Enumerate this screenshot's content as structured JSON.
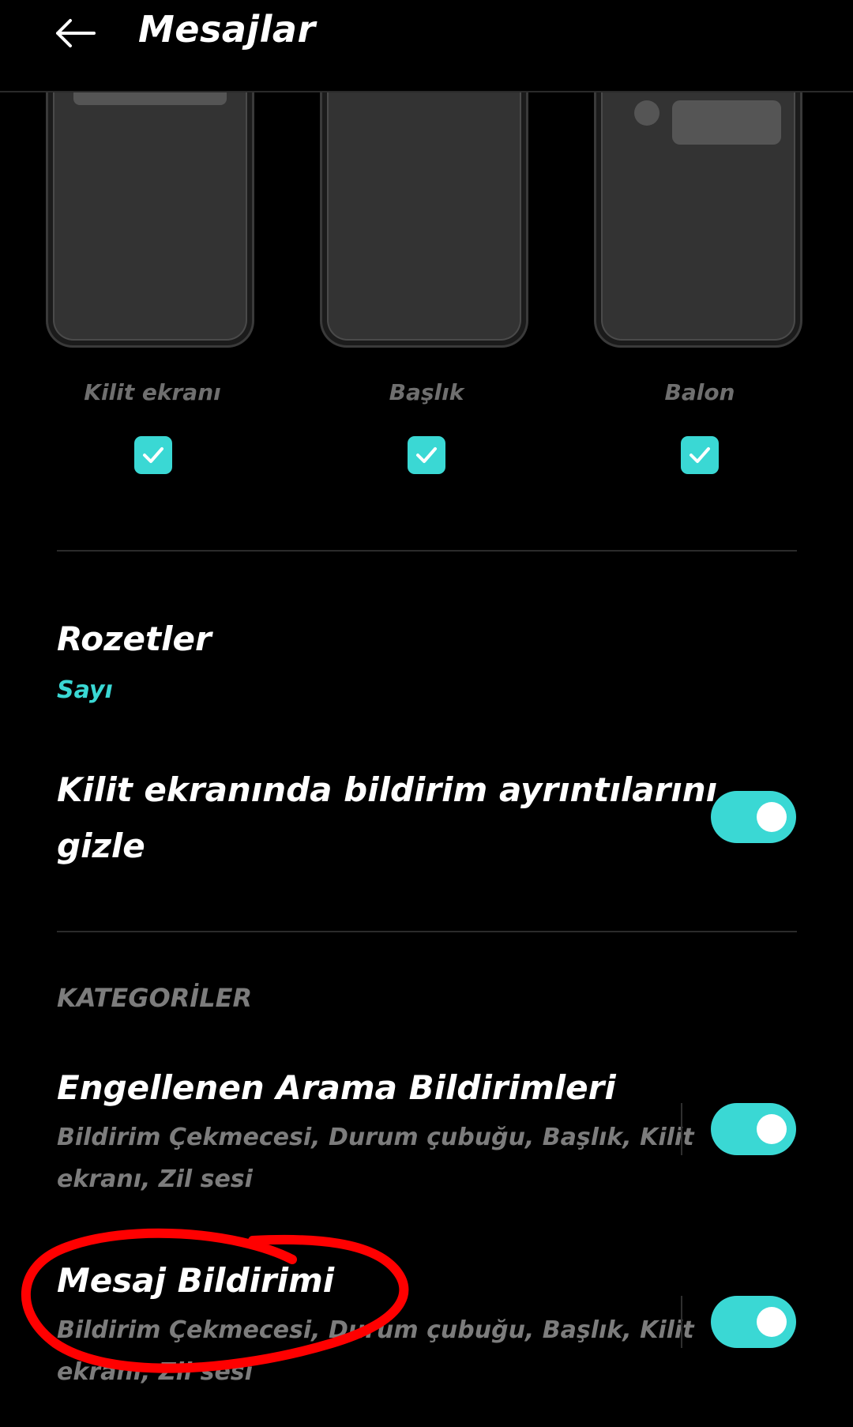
{
  "header": {
    "back_icon": "arrow-left-icon",
    "title": "Mesajlar"
  },
  "previews": [
    {
      "label": "Kilit ekranı",
      "checked": true
    },
    {
      "label": "Başlık",
      "checked": true
    },
    {
      "label": "Balon",
      "checked": true
    }
  ],
  "badges": {
    "title": "Rozetler",
    "value": "Sayı"
  },
  "hide_details": {
    "title_line1": "Kilit ekranında bildirim ayrıntılarını",
    "title_line2": "gizle",
    "enabled": true
  },
  "categories": {
    "header": "KATEGORİLER",
    "items": [
      {
        "title": "Engellenen Arama Bildirimleri",
        "sub_line1": "Bildirim Çekmecesi, Durum çubuğu, Başlık, Kilit",
        "sub_line2": "ekranı, Zil sesi",
        "enabled": true
      },
      {
        "title": "Mesaj Bildirimi",
        "sub_line1": "Bildirim Çekmecesi, Durum çubuğu, Başlık, Kilit",
        "sub_line2": "ekranı, Zil sesi",
        "enabled": true
      }
    ]
  },
  "colors": {
    "accent": "#3ad8d4",
    "annotation": "#ff0000",
    "background": "#000000"
  }
}
